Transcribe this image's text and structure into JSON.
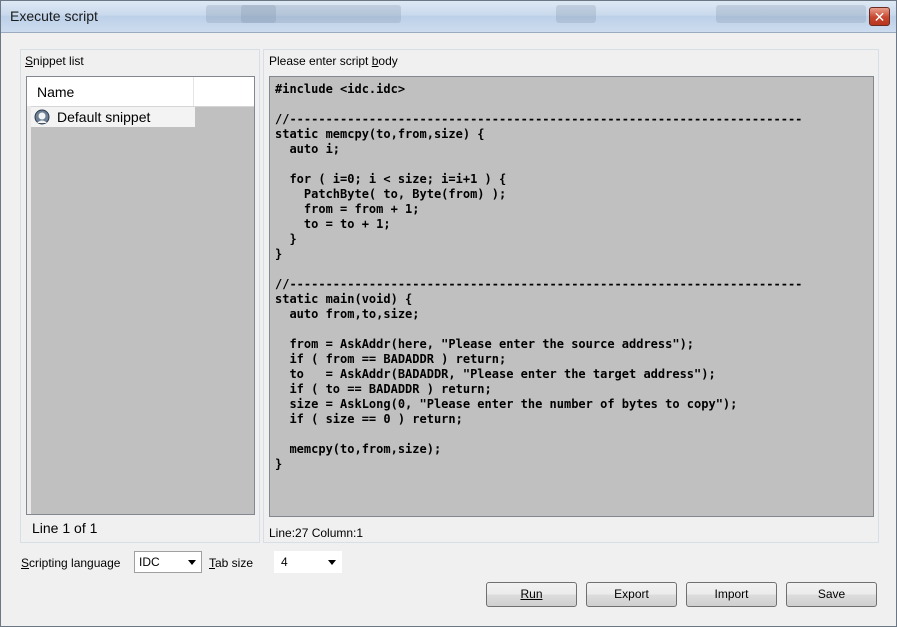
{
  "window": {
    "title": "Execute script",
    "close_label": "✕"
  },
  "snippets": {
    "group_label": "Snippet list",
    "column_header": "Name",
    "items": [
      {
        "label": "Default snippet",
        "icon": "snippet-icon"
      }
    ],
    "status": "Line 1 of 1"
  },
  "editor": {
    "group_label": "Please enter script body",
    "code": "#include <idc.idc>\n\n//-----------------------------------------------------------------------\nstatic memcpy(to,from,size) {\n  auto i;\n\n  for ( i=0; i < size; i=i+1 ) {\n    PatchByte( to, Byte(from) );\n    from = from + 1;\n    to = to + 1;\n  }\n}\n\n//-----------------------------------------------------------------------\nstatic main(void) {\n  auto from,to,size;\n\n  from = AskAddr(here, \"Please enter the source address\");\n  if ( from == BADADDR ) return;\n  to   = AskAddr(BADADDR, \"Please enter the target address\");\n  if ( to == BADADDR ) return;\n  size = AskLong(0, \"Please enter the number of bytes to copy\");\n  if ( size == 0 ) return;\n\n  memcpy(to,from,size);\n}",
    "status": "Line:27  Column:1"
  },
  "options": {
    "language_label": "Scripting language",
    "language_value": "IDC",
    "tabsize_label": "Tab size",
    "tabsize_value": "4"
  },
  "buttons": {
    "run": "Run",
    "export": "Export",
    "import": "Import",
    "save": "Save"
  }
}
